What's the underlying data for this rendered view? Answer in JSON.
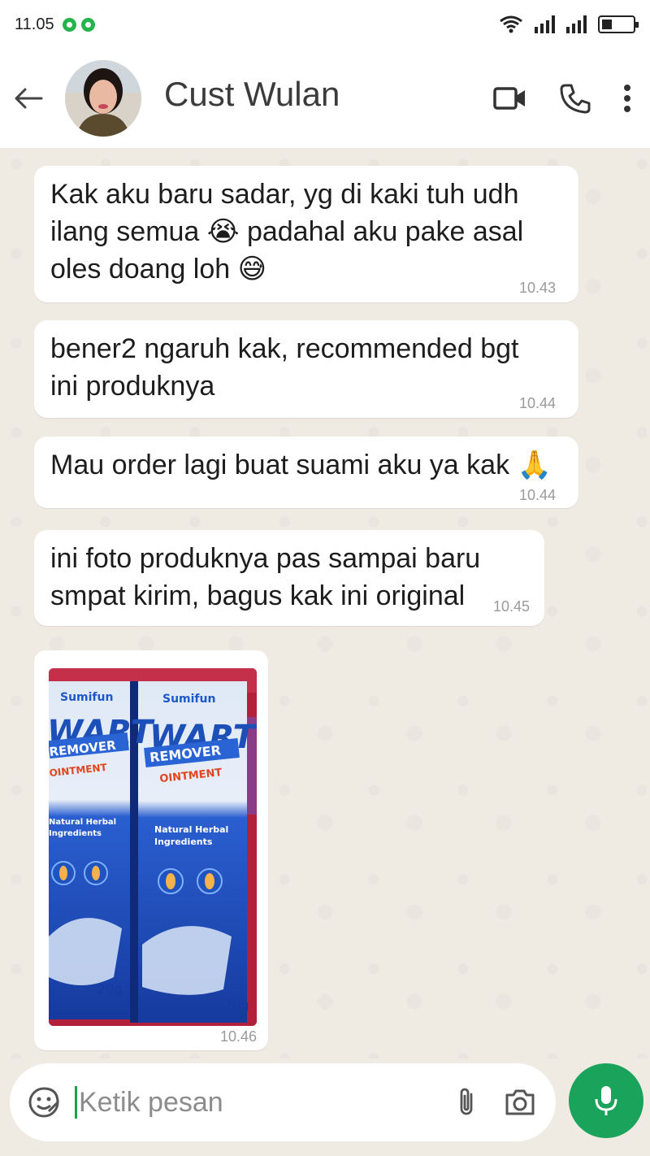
{
  "status_bar": {
    "time": "11.05",
    "notification_icons": [
      "whatsapp-icon",
      "whatsapp-icon"
    ],
    "right_icons": [
      "wifi-icon",
      "signal-icon",
      "signal-icon",
      "battery-icon"
    ]
  },
  "header": {
    "contact_name": "Cust Wulan",
    "icons": [
      "back-arrow-icon",
      "video-call-icon",
      "phone-icon",
      "more-vert-icon"
    ]
  },
  "messages": [
    {
      "lines": [
        "Kak aku baru sadar, yg di kaki tuh udh",
        "ilang semua 😭 padahal aku pake asal",
        "oles doang loh 😅"
      ],
      "time": "10.43"
    },
    {
      "lines": [
        "bener2 ngaruh kak, recommended bgt",
        "ini produknya"
      ],
      "time": "10.44"
    },
    {
      "lines": [
        "Mau order lagi buat suami aku ya kak 🙏"
      ],
      "time": "10.44"
    },
    {
      "lines": [
        "ini foto produknya pas sampai baru",
        "smpat kirim, bagus kak ini original"
      ],
      "time": "10.45"
    }
  ],
  "photo_message": {
    "time": "10.46",
    "product": {
      "brand": "Sumifun",
      "line1": "WART",
      "line2": "REMOVER",
      "line3": "OINTMENT",
      "tagline1": "Natural Herbal",
      "tagline2": "Ingredients",
      "weight": "20g"
    }
  },
  "input": {
    "placeholder": "Ketik pesan",
    "icons": [
      "emoji-icon",
      "attach-icon",
      "camera-icon",
      "mic-icon"
    ]
  },
  "colors": {
    "chat_background": "#efeae2",
    "bubble": "#ffffff",
    "accent_green": "#1aa35b",
    "product_blue": "#1a3ea8"
  }
}
